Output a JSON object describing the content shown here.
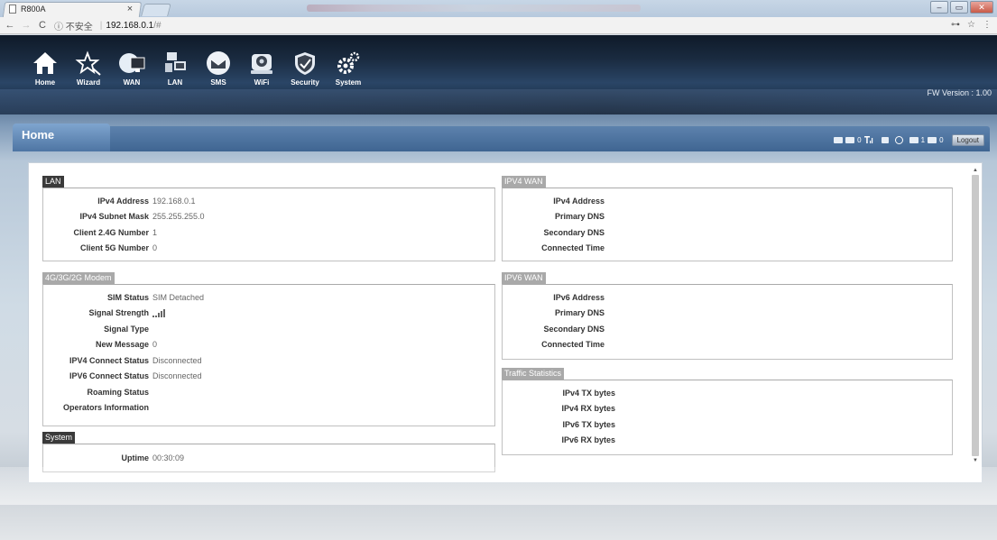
{
  "browser": {
    "tab_title": "R800A",
    "tab_close": "×",
    "nav_back": "←",
    "nav_forward": "→",
    "nav_reload": "C",
    "security_label": "ⓘ 不安全",
    "url_separator": "|",
    "url_host": "192.168.0.1",
    "url_hash": "/#",
    "key_icon": "⊶",
    "star_icon": "☆",
    "menu_icon": "⋮",
    "win_minimize": "–",
    "win_restore": "▭",
    "win_close": "✕"
  },
  "topnav": {
    "items": [
      {
        "label": "Home",
        "icon": "home-icon"
      },
      {
        "label": "Wizard",
        "icon": "wizard-icon"
      },
      {
        "label": "WAN",
        "icon": "wan-icon"
      },
      {
        "label": "LAN",
        "icon": "lan-icon"
      },
      {
        "label": "SMS",
        "icon": "sms-icon"
      },
      {
        "label": "WiFi",
        "icon": "wifi-icon"
      },
      {
        "label": "Security",
        "icon": "security-icon"
      },
      {
        "label": "System",
        "icon": "system-icon"
      }
    ],
    "fw_version": "FW Version : 1.00"
  },
  "page": {
    "title": "Home",
    "status": {
      "sms_count": "0",
      "connected_count": "1",
      "wifi_count": "0"
    },
    "logout_label": "Logout"
  },
  "lan": {
    "title": "LAN",
    "rows": [
      {
        "k": "IPv4 Address",
        "v": "192.168.0.1"
      },
      {
        "k": "IPv4 Subnet Mask",
        "v": "255.255.255.0"
      },
      {
        "k": "Client 2.4G Number",
        "v": "1"
      },
      {
        "k": "Client 5G Number",
        "v": "0"
      }
    ]
  },
  "modem": {
    "title": "4G/3G/2G Modem",
    "rows": [
      {
        "k": "SIM Status",
        "v": "SIM Detached"
      },
      {
        "k": "Signal Strength",
        "v": ""
      },
      {
        "k": "Signal Type",
        "v": ""
      },
      {
        "k": "New Message",
        "v": "0"
      },
      {
        "k": "IPV4 Connect Status",
        "v": "Disconnected"
      },
      {
        "k": "IPV6 Connect Status",
        "v": "Disconnected"
      },
      {
        "k": "Roaming Status",
        "v": ""
      },
      {
        "k": "Operators Information",
        "v": ""
      }
    ]
  },
  "system": {
    "title": "System",
    "rows": [
      {
        "k": "Uptime",
        "v": "00:30:09"
      }
    ]
  },
  "ipv4wan": {
    "title": "IPV4 WAN",
    "rows": [
      {
        "k": "IPv4 Address",
        "v": ""
      },
      {
        "k": "Primary DNS",
        "v": ""
      },
      {
        "k": "Secondary DNS",
        "v": ""
      },
      {
        "k": "Connected Time",
        "v": ""
      }
    ]
  },
  "ipv6wan": {
    "title": "IPV6 WAN",
    "rows": [
      {
        "k": "IPv6 Address",
        "v": ""
      },
      {
        "k": "Primary DNS",
        "v": ""
      },
      {
        "k": "Secondary DNS",
        "v": ""
      },
      {
        "k": "Connected Time",
        "v": ""
      }
    ]
  },
  "traffic": {
    "title": "Traffic Statistics",
    "rows": [
      {
        "k": "IPv4 TX bytes",
        "v": ""
      },
      {
        "k": "IPv4 RX bytes",
        "v": ""
      },
      {
        "k": "IPv6 TX bytes",
        "v": ""
      },
      {
        "k": "IPv6 RX bytes",
        "v": ""
      }
    ]
  }
}
